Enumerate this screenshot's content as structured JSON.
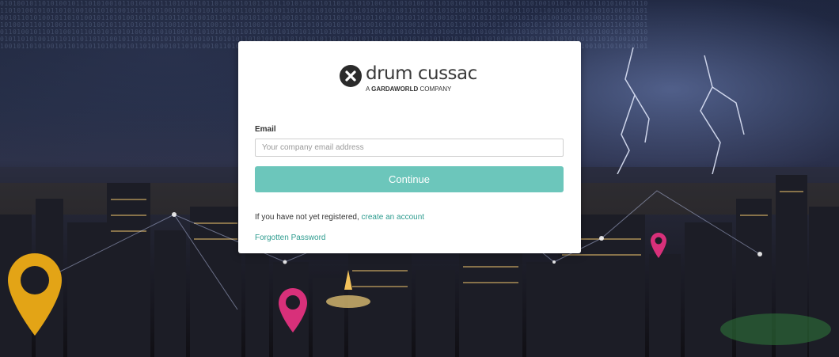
{
  "logo": {
    "wordmark": "drum cussac",
    "tagline_prefix": "A ",
    "tagline_brand": "GARDAWORLD",
    "tagline_suffix": " COMPANY"
  },
  "form": {
    "email_label": "Email",
    "email_value": "",
    "email_placeholder": "Your company email address",
    "continue_label": "Continue",
    "register_text": "If you have not yet registered, ",
    "register_link": "create an account",
    "forgot_link": "Forgotten Password"
  },
  "colors": {
    "accent": "#6cc6bb",
    "link": "#2e9c8f",
    "pin_yellow": "#e3a416",
    "pin_pink": "#d8307a"
  }
}
